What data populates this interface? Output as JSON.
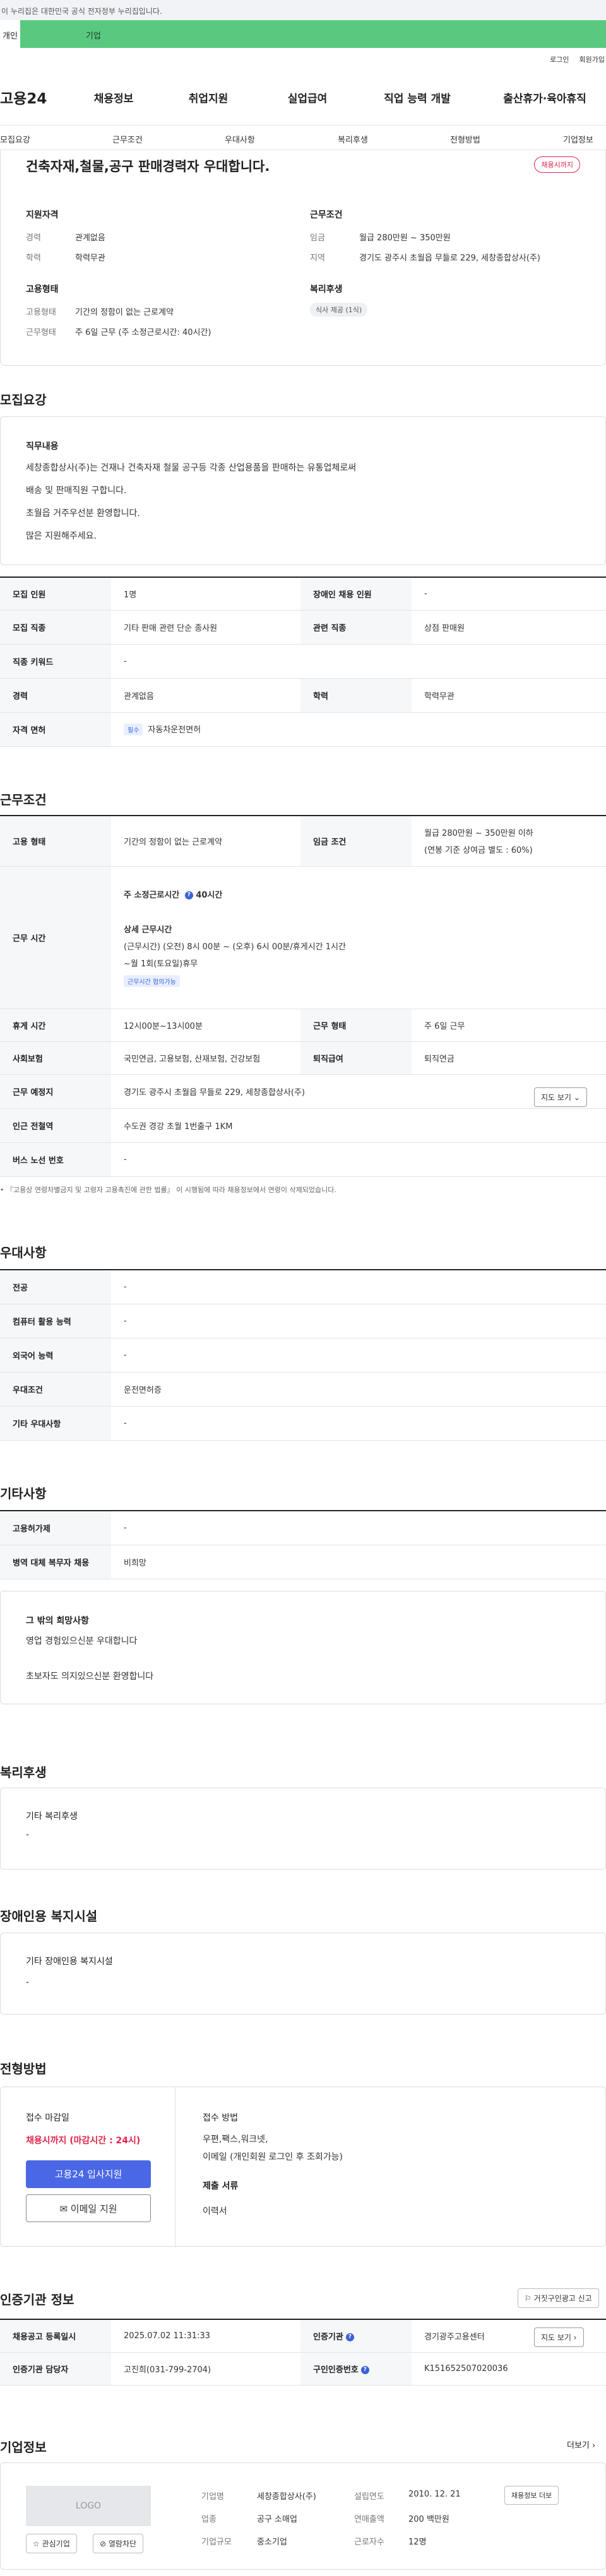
{
  "gov_bar": "이 누리집은 대한민국 공식 전자정부 누리집입니다.",
  "audience_tabs": [
    "개인",
    "기업"
  ],
  "top_links": [
    "로그인",
    "회원가입"
  ],
  "logo": "고용24",
  "gnb": [
    "채용정보",
    "취업지원",
    "실업급여",
    "직업 능력 개발",
    "출산휴가·육아휴직"
  ],
  "subnav": [
    "모집요강",
    "근무조건",
    "우대사항",
    "복리후생",
    "전형방법",
    "기업정보"
  ],
  "summary": {
    "title": "건축자재,철물,공구 판매경력자 우대합니다.",
    "status": "채용시까지",
    "qual_h": "지원자격",
    "career_l": "경력",
    "career_v": "관계없음",
    "edu_l": "학력",
    "edu_v": "학력무관",
    "cond_h": "근무조건",
    "wage_l": "임금",
    "wage_v": "월급 280만원 ~ 350만원",
    "area_l": "지역",
    "area_v": "경기도 광주시 초월읍 무들로 229, 세창종합상사(주)",
    "emp_h": "고용형태",
    "emptype_l": "고용형태",
    "emptype_v": "기간의 정함이 없는 근로계약",
    "worktype_l": "근무형태",
    "worktype_v": "주 6일 근무 (주 소정근로시간: 40시간)",
    "welfare_h": "복리후생",
    "welfare_chip": "식사 제공 (1식)"
  },
  "recruit": {
    "title": "모집요강",
    "duty_h": "직무내용",
    "duty_lines": [
      "세창종합상사(주)는 건재나 건축자재 철물 공구등  각종 산업용품을 판매하는 유통업체로써",
      "배송 및 판매직원 구합니다.",
      "초월읍 거주우선분 환영합니다.",
      "많은 지원해주세요."
    ],
    "rows": [
      [
        "모집 인원",
        "1명",
        "장애인 채용 인원",
        "-"
      ],
      [
        "모집 직종",
        "기타 판매 관련 단순 종사원",
        "관련 직종",
        "상점 판매원"
      ],
      [
        "직종 키워드",
        "-",
        "",
        ""
      ],
      [
        "경력",
        "관계없음",
        "학력",
        "학력무관"
      ]
    ],
    "license_l": "자격 면허",
    "license_tag": "필수",
    "license_v": "자동차운전면허"
  },
  "work": {
    "title": "근무조건",
    "emp_l": "고용 형태",
    "emp_v": "기간의 정함이 없는 근로계약",
    "wage_l": "임금 조건",
    "wage_v1": "월급 280만원 ~ 350만원 이하",
    "wage_v2": "(연봉 기준 상여금 별도 : 60%)",
    "hours_l": "근무 시간",
    "hours_week": "주 소정근로시간",
    "hours_week_v": "40시간",
    "hours_detail_h": "상세 근무시간",
    "hours_detail1": "(근무시간) (오전) 8시 00분 ~ (오후) 6시 00분/휴게시간 1시간",
    "hours_detail2": "~월 1회(토요일)휴무",
    "hours_tag": "근무시간 협의가능",
    "break_l": "휴게 시간",
    "break_v": "12시00분~13시00분",
    "form_l": "근무 형태",
    "form_v": "주 6일 근무",
    "ins_l": "사회보험",
    "ins_v": "국민연금, 고용보험, 산재보험, 건강보험",
    "ret_l": "퇴직급여",
    "ret_v": "퇴직연금",
    "place_l": "근무 예정지",
    "place_v": "경기도 광주시 초월읍 무들로 229, 세창종합상사(주)",
    "map_btn": "지도 보기 ⌄",
    "subway_l": "인근 전철역",
    "subway_v": "수도권 경강 초월 1번출구 1KM",
    "bus_l": "버스 노선 번호",
    "bus_v": "-",
    "note": "• 『고용상 연령차별금지 및 고령자 고용촉진에 관한 법률』 이 시행됨에 따라 채용정보에서 연령이 삭제되었습니다."
  },
  "prefer": {
    "title": "우대사항",
    "rows": [
      [
        "전공",
        "-"
      ],
      [
        "컴퓨터 활용 능력",
        "-"
      ],
      [
        "외국어 능력",
        "-"
      ],
      [
        "우대조건",
        "운전면허증"
      ],
      [
        "기타 우대사항",
        "-"
      ]
    ]
  },
  "etc": {
    "title": "기타사항",
    "rows": [
      [
        "고용허가제",
        "-"
      ],
      [
        "병역 대체 복무자 채용",
        "비희망"
      ]
    ],
    "other_h": "그 밖의 희망사항",
    "other_lines": [
      "영업 경험있으신분 우대합니다",
      "초보자도 의지있으신분 환영합니다"
    ]
  },
  "welfare": {
    "title": "복리후생",
    "h": "기타 복리후생",
    "v": "-"
  },
  "disabled": {
    "title": "장애인용 복지시설",
    "h": "기타 장애인용 복지시설",
    "v": "-"
  },
  "process": {
    "title": "전형방법",
    "deadline_h": "접수 마감일",
    "deadline_v": "채용시까지 (마감시간 : 24시)",
    "apply_btn": "고용24 입사지원",
    "email_btn": "이메일 지원",
    "method_h": "접수 방법",
    "method_v1": "우편,팩스,워크넷,",
    "method_v2": "이메일 (개인회원 로그인 후 조회가능)",
    "docs_h": "제출 서류",
    "docs_v": "이력서"
  },
  "cert": {
    "title": "인증기관 정보",
    "report_btn": "거짓구인광고 신고",
    "reg_l": "채용공고 등록일시",
    "reg_v": "2025.07.02 11:31:33",
    "org_l": "인증기관",
    "org_v": "경기광주고용센터",
    "map_btn": "지도 보기 ›",
    "mgr_l": "인증기관 담당자",
    "mgr_v": "고진희(031-799-2704)",
    "no_l": "구인인증번호",
    "no_v": "K151652507020036"
  },
  "company": {
    "title": "기업정보",
    "more": "더보기 ›",
    "logo": "LOGO",
    "interest_btn": "관심기업",
    "block_btn": "열람차단",
    "name_l": "기업명",
    "name_v": "세창종합상사(주)",
    "ind_l": "업종",
    "ind_v": "공구 소매업",
    "size_l": "기업규모",
    "size_v": "중소기업",
    "est_l": "설립연도",
    "est_v": "2010. 12. 21",
    "sales_l": "연매출액",
    "sales_v": "200 백만원",
    "emp_l": "근로자수",
    "emp_v": "12명",
    "jobs_btn": "채용정보 더보"
  },
  "colors": {
    "accent_green": "#59c97f",
    "apply_blue": "#4a67e6",
    "status_red": "#e0244a"
  }
}
